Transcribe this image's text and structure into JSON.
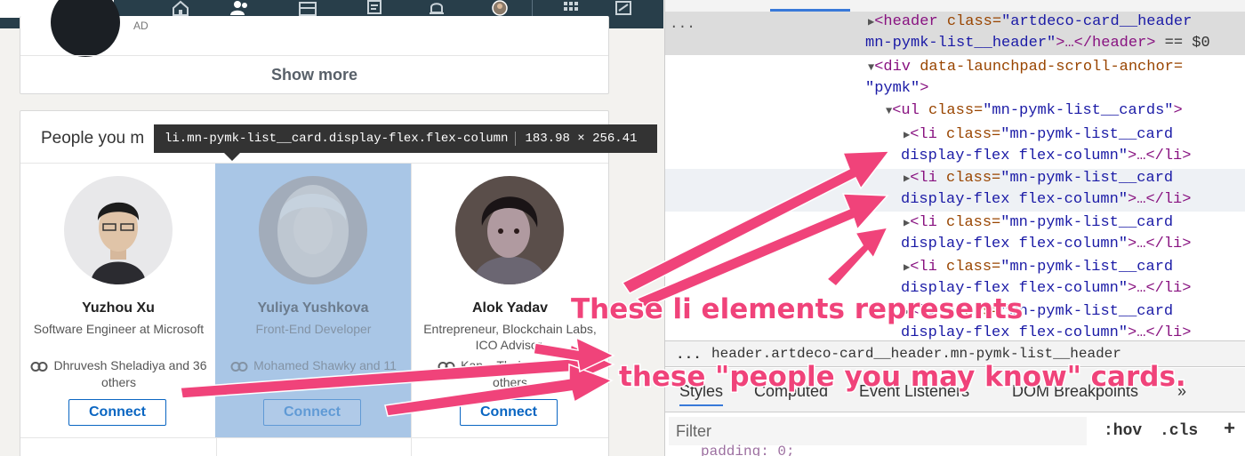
{
  "app": {
    "topnav": {
      "icons": [
        "home-icon",
        "my-network-icon",
        "jobs-icon",
        "messaging-icon",
        "notifications-icon",
        "me-avatar-icon",
        "work-grid-icon",
        "post-job-icon"
      ]
    },
    "top_card": {
      "headline_fragment": "AD",
      "show_more_label": "Show more"
    },
    "pymk": {
      "title": "People you m",
      "people": [
        {
          "name": "Yuzhou Xu",
          "headline": "Software Engineer at Microsoft",
          "mutual": "Dhruvesh Sheladiya and 36 others",
          "connect_label": "Connect"
        },
        {
          "name": "Yuliya Yushkova",
          "headline": "Front-End Developer",
          "mutual": "Mohamed Shawky and 11 others",
          "connect_label": "Connect"
        },
        {
          "name": "Alok Yadav",
          "headline": "Entrepreneur, Blockchain Labs, ICO Advisor,",
          "mutual": "Kap... Thulasi Doss ... others",
          "connect_label": "Connect"
        }
      ]
    },
    "inspector_tooltip": {
      "selector": "li.mn-pymk-list__card.display-flex.flex-column",
      "size": "183.98 × 256.41"
    }
  },
  "devtools": {
    "ellipsis": "...",
    "dom": {
      "header_line1_tag": "<header ",
      "header_line1_attr": "class=",
      "header_line1_val": "\"artdeco-card__header",
      "header_line2_val": "mn-pymk-list__header\"",
      "header_line2_rest": ">…</header>",
      "header_line2_suffix": " == $0",
      "div_line1_tag": "<div ",
      "div_line1_attr": "data-launchpad-scroll-anchor=",
      "div_line2_val": "\"pymk\"",
      "div_line2_tag": ">",
      "ul_tag": "<ul ",
      "ul_attr": "class=",
      "ul_val": "\"mn-pymk-list__cards\"",
      "ul_close": ">",
      "li_tag": "<li ",
      "li_attr": "class=",
      "li_val1": "\"mn-pymk-list__card",
      "li_val2": "display-flex flex-column\"",
      "li_close": ">…</li>"
    },
    "breadcrumb": {
      "dots": "...",
      "path": "header.artdeco-card__header.mn-pymk-list__header"
    },
    "subtabs": [
      "Styles",
      "Computed",
      "Event Listeners",
      "DOM Breakpoints",
      "»"
    ],
    "filter": {
      "placeholder": "Filter",
      "hov_label": ":hov",
      "cls_label": ".cls",
      "add_label": "+"
    },
    "peek_text": "padding: 0;"
  },
  "annotation": {
    "line1": "These li elements represents",
    "line2": "these \"people you may know\" cards.",
    "color": "#f0437a"
  }
}
